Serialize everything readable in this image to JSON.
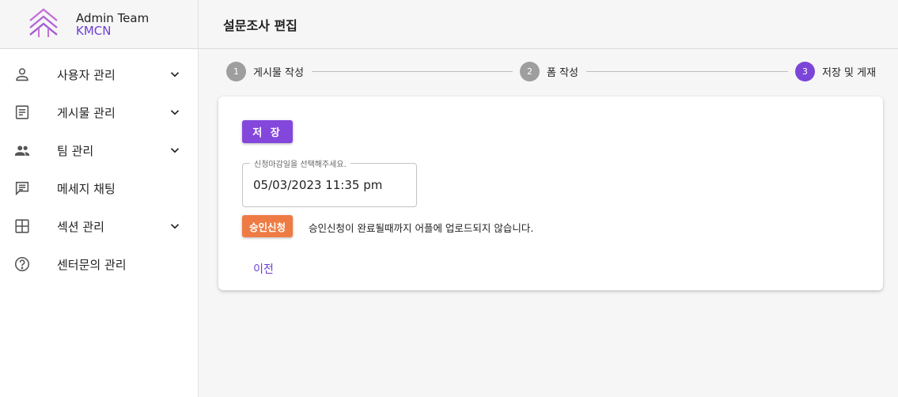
{
  "brand": {
    "title": "Admin Team",
    "subtitle": "KMCN",
    "logo_icon": "chevron-stack-logo",
    "accent": "#6f3fd6"
  },
  "sidebar": {
    "items": [
      {
        "label": "사용자 관리",
        "icon": "person-icon",
        "expandable": true
      },
      {
        "label": "게시물 관리",
        "icon": "document-icon",
        "expandable": true
      },
      {
        "label": "팀 관리",
        "icon": "group-icon",
        "expandable": true
      },
      {
        "label": "메세지 채팅",
        "icon": "chat-icon",
        "expandable": false
      },
      {
        "label": "섹션 관리",
        "icon": "layout-icon",
        "expandable": true
      },
      {
        "label": "센터문의 관리",
        "icon": "help-icon",
        "expandable": false
      }
    ]
  },
  "header": {
    "title": "설문조사 편집"
  },
  "stepper": {
    "steps": [
      {
        "number": "1",
        "label": "게시물 작성",
        "active": false
      },
      {
        "number": "2",
        "label": "폼 작성",
        "active": false
      },
      {
        "number": "3",
        "label": "저장 및 게재",
        "active": true
      }
    ],
    "active_color": "#7b45d8",
    "inactive_color": "#9e9e9e"
  },
  "form": {
    "save_label": "저 장",
    "deadline_label": "신청마감일을 선택해주세요.",
    "deadline_value": "05/03/2023 11:35 pm",
    "approve_label": "승인신청",
    "approve_color": "#ef7b44",
    "notice_text": "승인신청이 완료될때까지 어플에 업로드되지 않습니다.",
    "prev_label": "이전"
  }
}
